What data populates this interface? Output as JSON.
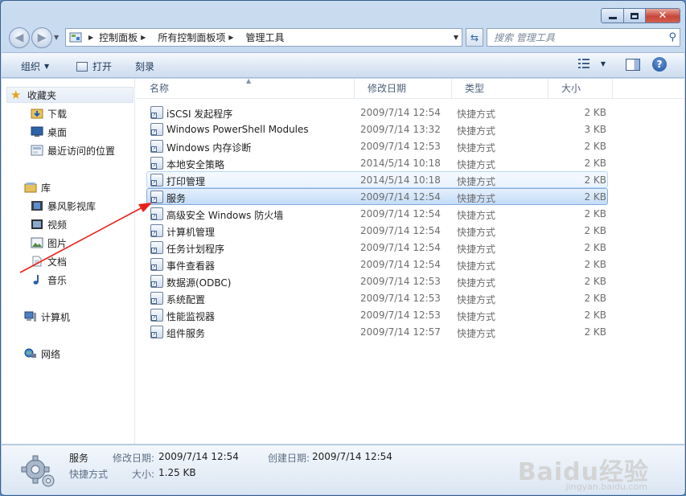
{
  "window": {
    "caption": {
      "min": "",
      "max": "",
      "close": "✕"
    }
  },
  "address_bar": {
    "segments": [
      "控制面板",
      "所有控制面板项",
      "管理工具"
    ]
  },
  "search": {
    "placeholder": "搜索 管理工具"
  },
  "toolbar": {
    "organize": "组织",
    "open": "打开",
    "burn": "刻录"
  },
  "nav": {
    "favorites": {
      "label": "收藏夹",
      "items": [
        "下载",
        "桌面",
        "最近访问的位置"
      ]
    },
    "libraries": {
      "label": "库",
      "items": [
        "暴风影视库",
        "视频",
        "图片",
        "文档",
        "音乐"
      ]
    },
    "computer": "计算机",
    "network": "网络"
  },
  "columns": {
    "name": "名称",
    "date": "修改日期",
    "type": "类型",
    "size": "大小"
  },
  "files": [
    {
      "name": "iSCSI 发起程序",
      "date": "2009/7/14 12:54",
      "type": "快捷方式",
      "size": "2 KB"
    },
    {
      "name": "Windows PowerShell Modules",
      "date": "2009/7/14 13:32",
      "type": "快捷方式",
      "size": "3 KB"
    },
    {
      "name": "Windows 内存诊断",
      "date": "2009/7/14 12:53",
      "type": "快捷方式",
      "size": "2 KB"
    },
    {
      "name": "本地安全策略",
      "date": "2014/5/14 10:18",
      "type": "快捷方式",
      "size": "2 KB"
    },
    {
      "name": "打印管理",
      "date": "2014/5/14 10:18",
      "type": "快捷方式",
      "size": "2 KB"
    },
    {
      "name": "服务",
      "date": "2009/7/14 12:54",
      "type": "快捷方式",
      "size": "2 KB"
    },
    {
      "name": "高级安全 Windows 防火墙",
      "date": "2009/7/14 12:54",
      "type": "快捷方式",
      "size": "2 KB"
    },
    {
      "name": "计算机管理",
      "date": "2009/7/14 12:54",
      "type": "快捷方式",
      "size": "2 KB"
    },
    {
      "name": "任务计划程序",
      "date": "2009/7/14 12:54",
      "type": "快捷方式",
      "size": "2 KB"
    },
    {
      "name": "事件查看器",
      "date": "2009/7/14 12:54",
      "type": "快捷方式",
      "size": "2 KB"
    },
    {
      "name": "数据源(ODBC)",
      "date": "2009/7/14 12:53",
      "type": "快捷方式",
      "size": "2 KB"
    },
    {
      "name": "系统配置",
      "date": "2009/7/14 12:53",
      "type": "快捷方式",
      "size": "2 KB"
    },
    {
      "name": "性能监视器",
      "date": "2009/7/14 12:53",
      "type": "快捷方式",
      "size": "2 KB"
    },
    {
      "name": "组件服务",
      "date": "2009/7/14 12:57",
      "type": "快捷方式",
      "size": "2 KB"
    }
  ],
  "details": {
    "name": "服务",
    "kind": "快捷方式",
    "modified_label": "修改日期:",
    "modified": "2009/7/14 12:54",
    "created_label": "创建日期:",
    "created": "2009/7/14 12:54",
    "size_label": "大小:",
    "size": "1.25 KB"
  },
  "watermark": {
    "main": "Baidu经验",
    "sub": "jingyan.baidu.com"
  },
  "colors": {
    "selection": "#c4dcf8",
    "hover": "#e9f2fd",
    "annotation_arrow": "#e8201a"
  }
}
